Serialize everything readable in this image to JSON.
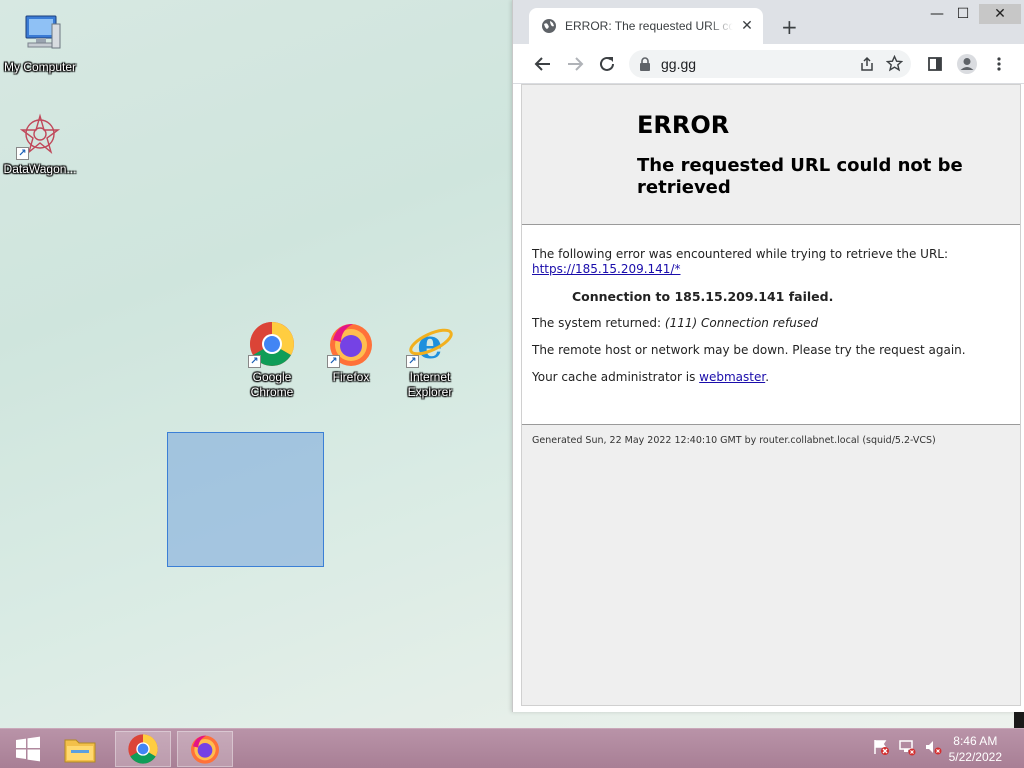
{
  "desktop": {
    "icons": [
      {
        "label": "My Computer",
        "icon": "computer-icon"
      },
      {
        "label": "DataWagon...",
        "icon": "datawagon-icon"
      },
      {
        "label": "Google Chrome",
        "icon": "chrome-icon"
      },
      {
        "label": "Firefox",
        "icon": "firefox-icon"
      },
      {
        "label": "Internet Explorer",
        "icon": "ie-icon"
      }
    ]
  },
  "browser": {
    "tab_title": "ERROR: The requested URL could not be retrieved",
    "new_tab": "+",
    "address": "gg.gg",
    "window_controls": {
      "minimize": "—",
      "maximize": "☐",
      "close": "✕"
    }
  },
  "page": {
    "heading": "ERROR",
    "subheading": "The requested URL could not be retrieved",
    "intro": "The following error was encountered while trying to retrieve the URL:",
    "url_link": "https://185.15.209.141/*",
    "failure": "Connection to 185.15.209.141 failed.",
    "system_returned_label": "The system returned:",
    "system_returned_value": "(111) Connection refused",
    "remote_down": "The remote host or network may be down. Please try the request again.",
    "cache_admin_label": "Your cache administrator is",
    "cache_admin_link": "webmaster",
    "cache_admin_suffix": ".",
    "generated": "Generated Sun, 22 May 2022 12:40:10 GMT by router.collabnet.local (squid/5.2-VCS)"
  },
  "taskbar": {
    "items": [
      "start-button",
      "file-explorer-icon",
      "chrome-icon",
      "firefox-icon"
    ],
    "time": "8:46 AM",
    "date": "5/22/2022"
  }
}
